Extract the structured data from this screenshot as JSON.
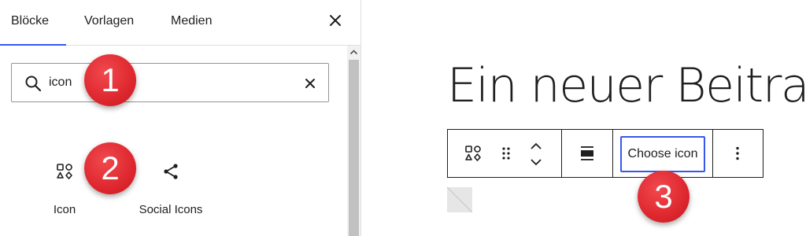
{
  "inserter": {
    "tabs": [
      {
        "label": "Blöcke",
        "active": true
      },
      {
        "label": "Vorlagen",
        "active": false
      },
      {
        "label": "Medien",
        "active": false
      }
    ],
    "close_icon": "close-icon",
    "search": {
      "value": "icon",
      "icon": "search-icon",
      "clear_icon": "clear-icon"
    },
    "results": [
      {
        "label": "Icon",
        "icon": "icon-block-icon"
      },
      {
        "label": "Social Icons",
        "icon": "share-icon"
      }
    ]
  },
  "editor": {
    "post_title": "Ein neuer Beitrag",
    "toolbar": {
      "block_type_icon": "icon-block-icon",
      "drag_icon": "drag-handle-icon",
      "move_up_icon": "chevron-up-icon",
      "move_down_icon": "chevron-down-icon",
      "align_icon": "align-icon",
      "choose_icon_label": "Choose icon",
      "more_icon": "more-options-icon"
    }
  },
  "callouts": [
    "1",
    "2",
    "3"
  ],
  "colors": {
    "accent": "#3858e9",
    "callout_red": "#e02a31",
    "text": "#1e1e1e",
    "border": "#949494"
  }
}
